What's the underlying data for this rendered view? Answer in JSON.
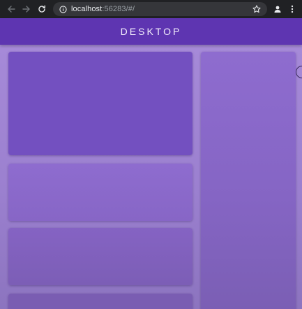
{
  "browser": {
    "url_host": "localhost",
    "url_path": ":56283/#/",
    "icons": {
      "back": "back-arrow-icon",
      "forward": "forward-arrow-icon",
      "reload": "reload-icon",
      "site_info": "info-icon",
      "bookmark": "star-icon",
      "profile": "profile-icon",
      "menu": "kebab-menu-icon"
    }
  },
  "app": {
    "title": "DESKTOP"
  },
  "colors": {
    "chrome_bg": "#202124",
    "omnibox_bg": "#35363a",
    "appbar": "#5e35b1",
    "page_bg": "#a68ad8",
    "primary_card": "#7350c0",
    "secondary_card": "#8e6ccf"
  }
}
